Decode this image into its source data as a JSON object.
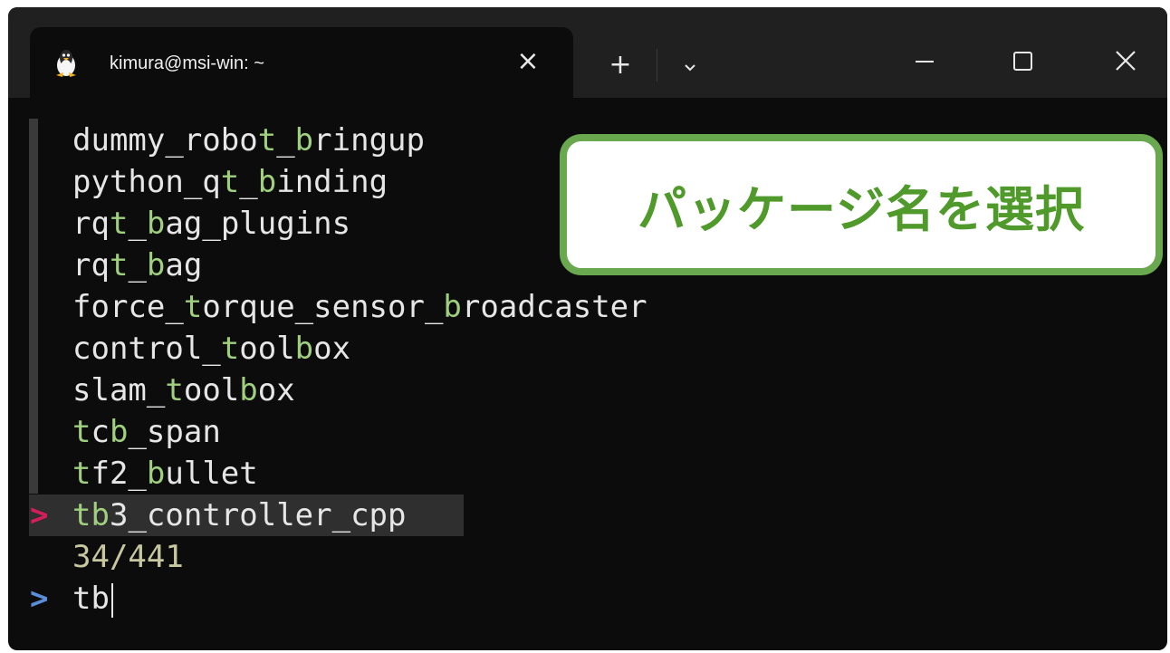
{
  "window": {
    "tab_title": "kimura@msi-win: ~",
    "tab_icon": "linux-penguin-icon",
    "close_tab_glyph": "×",
    "new_tab_glyph": "+",
    "dropdown_icon": "chevron-down-icon",
    "minimize_icon": "minimize-icon",
    "maximize_icon": "maximize-icon",
    "close_icon": "close-icon"
  },
  "terminal": {
    "list_items": [
      {
        "parts": [
          "dummy_robo",
          "t",
          "_",
          "b",
          "ringup"
        ],
        "match": [
          1,
          3
        ]
      },
      {
        "parts": [
          "python_q",
          "t",
          "_",
          "b",
          "inding"
        ],
        "match": [
          1,
          3
        ]
      },
      {
        "parts": [
          "rq",
          "t",
          "_",
          "b",
          "ag_plugins"
        ],
        "match": [
          1,
          3
        ]
      },
      {
        "parts": [
          "rq",
          "t",
          "_",
          "b",
          "ag"
        ],
        "match": [
          1,
          3
        ]
      },
      {
        "parts": [
          "force_",
          "t",
          "orque_sensor_",
          "b",
          "roadcaster"
        ],
        "match": [
          1,
          3
        ]
      },
      {
        "parts": [
          "control_",
          "t",
          "ool",
          "b",
          "ox"
        ],
        "match": [
          1,
          3
        ]
      },
      {
        "parts": [
          "slam_",
          "t",
          "ool",
          "b",
          "ox"
        ],
        "match": [
          1,
          3
        ]
      },
      {
        "parts": [
          "",
          "t",
          "c",
          "b",
          "_span"
        ],
        "match": [
          1,
          3
        ]
      },
      {
        "parts": [
          "",
          "t",
          "f2_",
          "b",
          "ullet"
        ],
        "match": [
          1,
          3
        ]
      }
    ],
    "selected_item": {
      "parts": [
        "",
        "t",
        "",
        "b",
        "3_controller_cpp"
      ],
      "match": [
        1,
        3
      ]
    },
    "selected_marker": ">",
    "match_count": "34/441",
    "prompt_symbol": ">",
    "query": "tb"
  },
  "callout": {
    "text": "パッケージ名を選択",
    "border_color": "#6aa84f",
    "text_color": "#4f9a2b"
  },
  "colors": {
    "terminal_bg": "#0c0c0c",
    "titlebar_bg": "#202020",
    "match_highlight": "#9fcf7f",
    "selected_marker": "#d51c5c",
    "prompt": "#5a8ed8"
  }
}
